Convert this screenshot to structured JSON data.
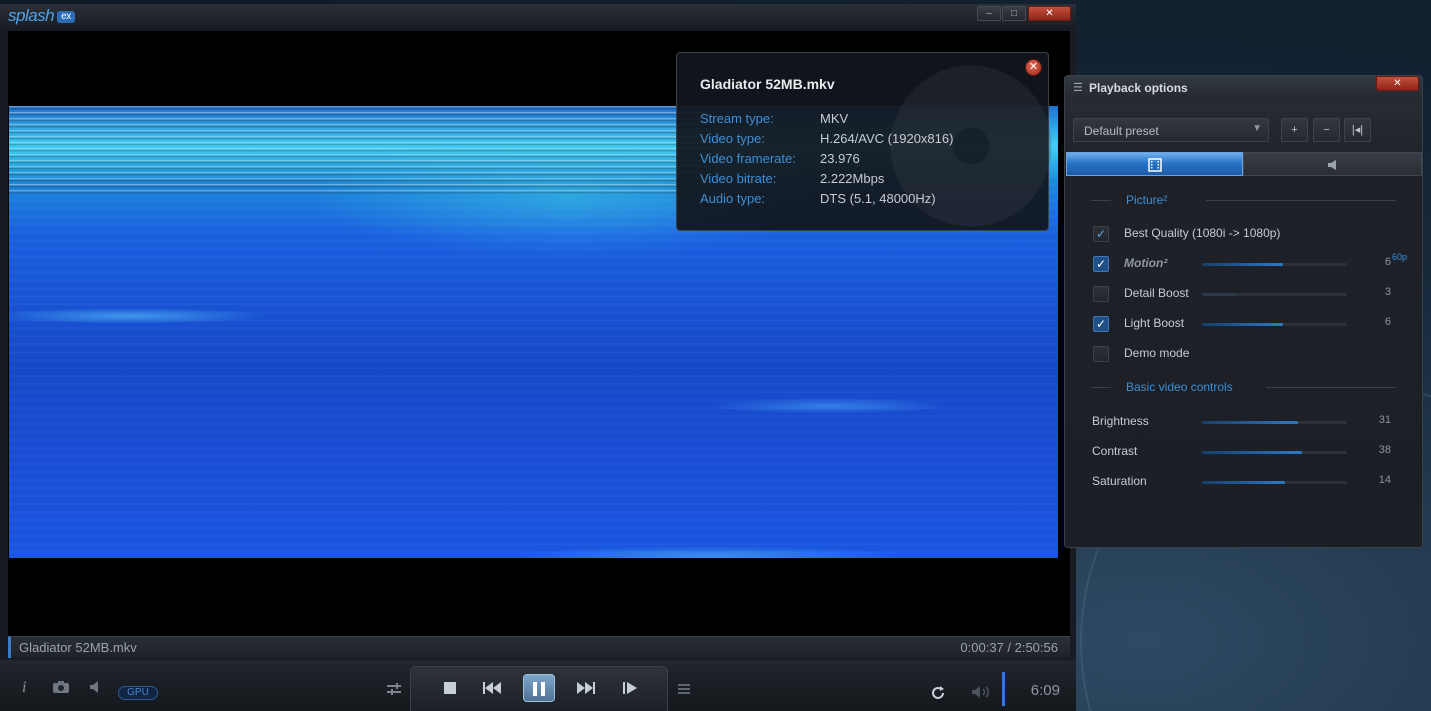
{
  "player": {
    "logo": "splash",
    "logo_badge": "ex",
    "window_buttons": {
      "minimize": "–",
      "maximize": "□",
      "close": "✕"
    },
    "status": {
      "file_name": "Gladiator 52MB.mkv",
      "time": "0:00:37 / 2:50:56"
    },
    "controls": {
      "info": "i",
      "gpu_label": "GPU",
      "clock": "6:09"
    },
    "icons": [
      "info-icon",
      "camera-icon",
      "speaker-icon",
      "equalizer-icon",
      "stop-icon",
      "previous-icon",
      "pause-icon",
      "next-icon",
      "frame-step-icon",
      "playlist-icon",
      "repeat-icon",
      "volume-icon"
    ]
  },
  "info_popup": {
    "title": "Gladiator 52MB.mkv",
    "rows": [
      {
        "key": "Stream type:",
        "value": "MKV"
      },
      {
        "key": "Video type:",
        "value": "H.264/AVC (1920x816)"
      },
      {
        "key": "Video framerate:",
        "value": "23.976"
      },
      {
        "key": "Video bitrate:",
        "value": "2.222Mbps"
      },
      {
        "key": "Audio type:",
        "value": "DTS (5.1, 48000Hz)"
      }
    ]
  },
  "playback_options": {
    "title": "Playback options",
    "preset": "Default preset",
    "tabs": [
      "video-tab",
      "audio-tab"
    ],
    "picture_section": "Picture²",
    "options": [
      {
        "label": "Best Quality (1080i -> 1080p)",
        "checked": true
      },
      {
        "label": "Motion²",
        "checked": true,
        "value": "6",
        "sup": "60p",
        "level": 0.56
      },
      {
        "label": "Detail Boost",
        "checked": false,
        "value": "3",
        "level": 0.24
      },
      {
        "label": "Light Boost",
        "checked": true,
        "value": "6",
        "level": 0.56
      },
      {
        "label": "Demo mode",
        "checked": false
      }
    ],
    "basic_section": "Basic video controls",
    "basic": [
      {
        "label": "Brightness",
        "value": "31",
        "level": 0.66
      },
      {
        "label": "Contrast",
        "value": "38",
        "level": 0.69
      },
      {
        "label": "Saturation",
        "value": "14",
        "level": 0.57
      }
    ]
  },
  "colors": {
    "accent": "#3d8fd7",
    "close": "#c4503e",
    "background": "#181c22"
  }
}
